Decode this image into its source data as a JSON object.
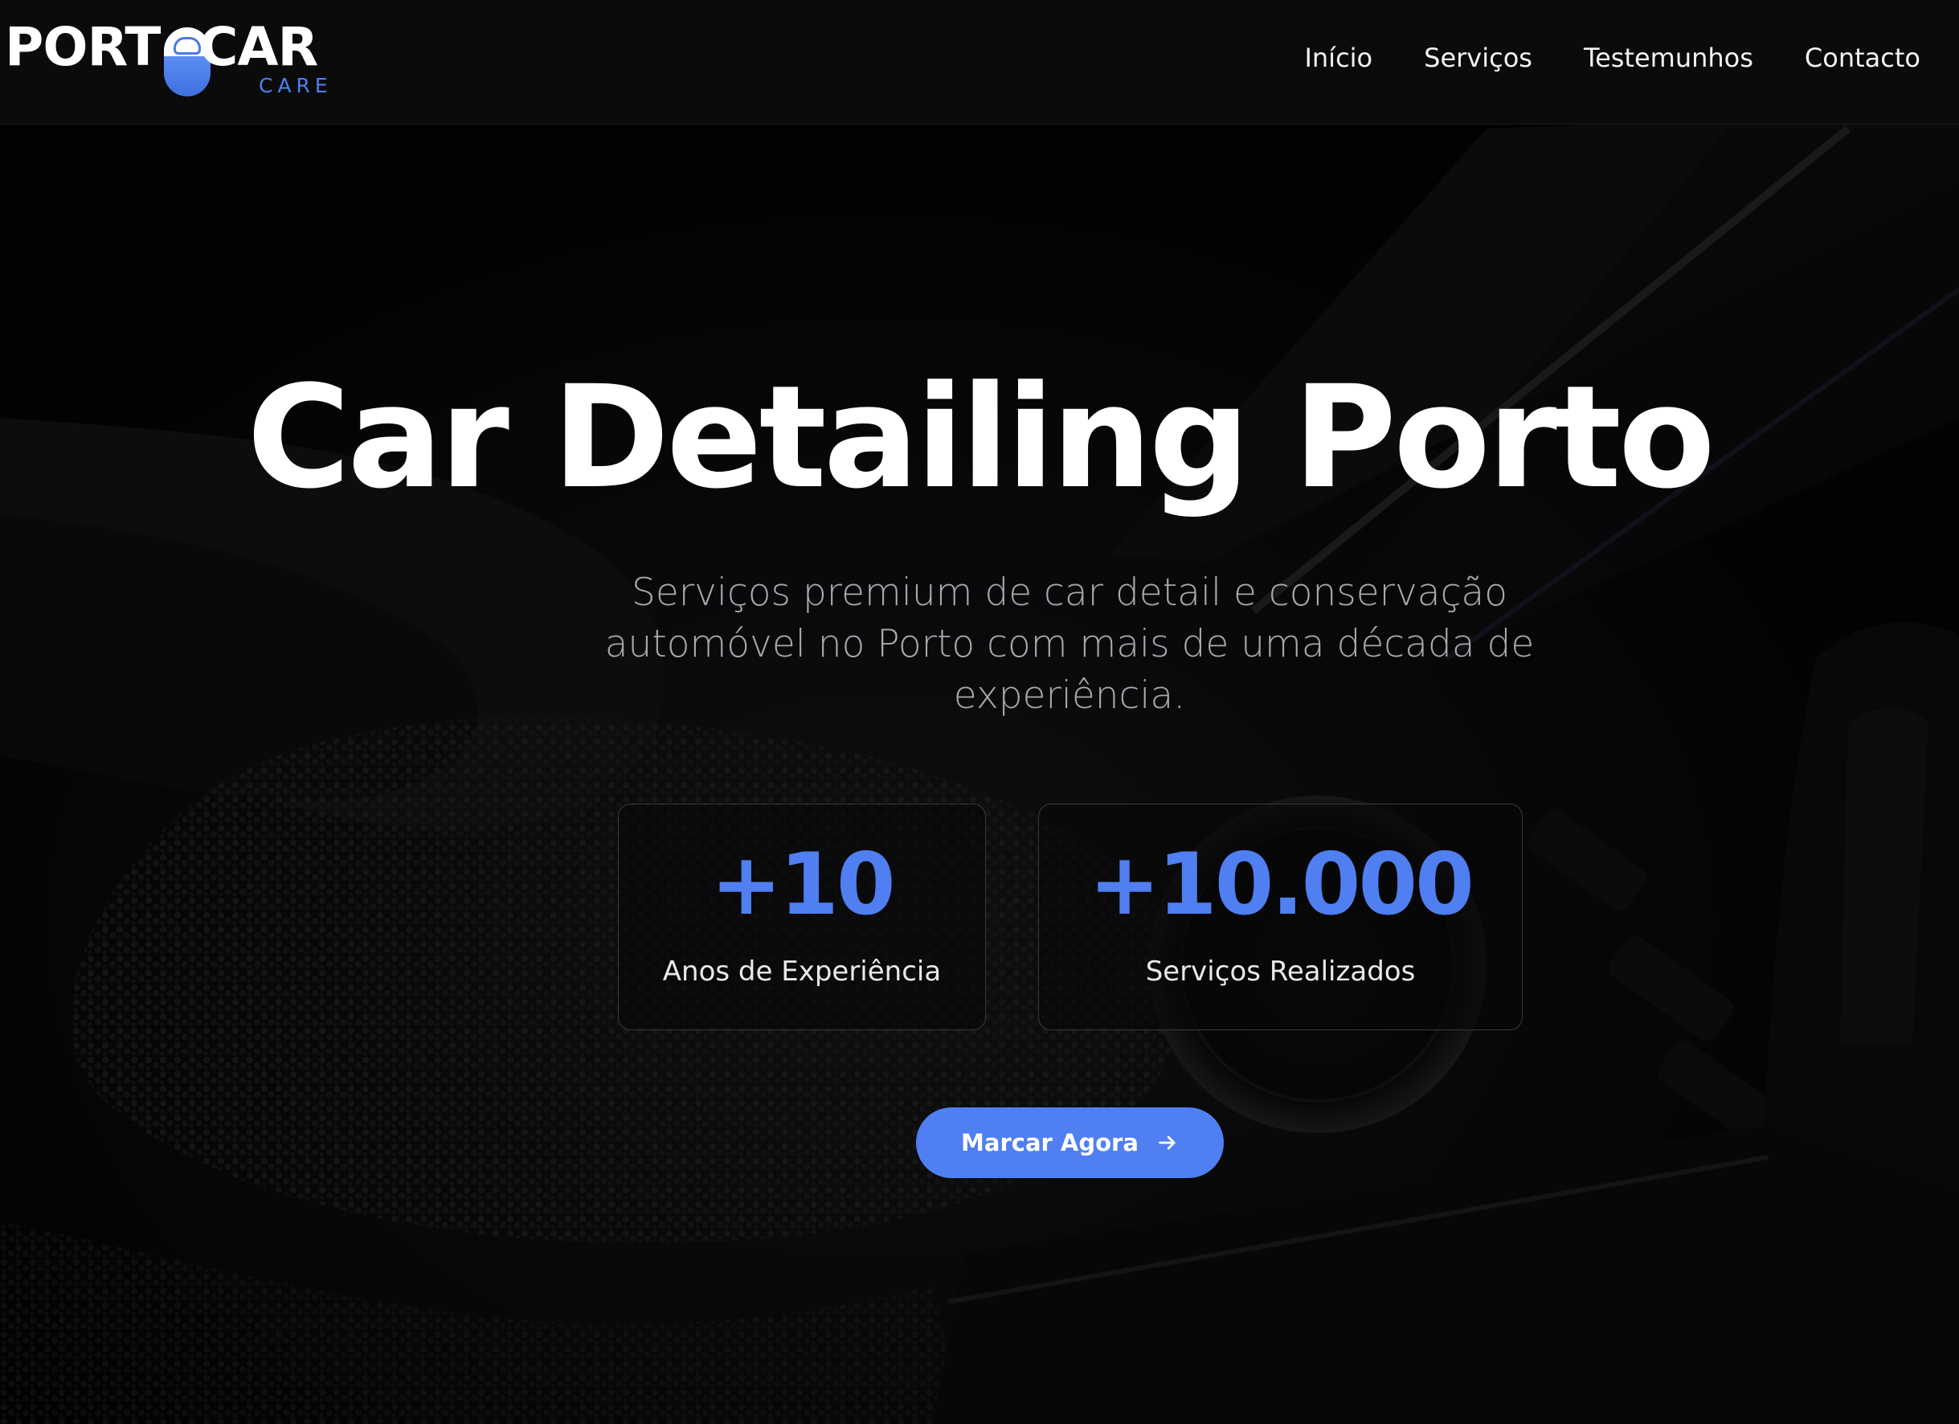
{
  "colors": {
    "accent": "#4f7ff0",
    "background": "#050506",
    "header_bg": "#0b0b0c"
  },
  "brand": {
    "word_left": "PORT",
    "word_right": "CAR",
    "sub": "CARE",
    "icon": "car-pill-logo-icon"
  },
  "nav": {
    "items": [
      {
        "label": "Início"
      },
      {
        "label": "Serviços"
      },
      {
        "label": "Testemunhos"
      },
      {
        "label": "Contacto"
      }
    ]
  },
  "hero": {
    "title": "Car Detailing Porto",
    "subtitle": "Serviços premium de car detail e conservação automóvel no Porto com mais de uma década de experiência."
  },
  "stats": [
    {
      "value": "+10",
      "label": "Anos de Experiência"
    },
    {
      "value": "+10.000",
      "label": "Serviços Realizados"
    }
  ],
  "cta": {
    "label": "Marcar Agora",
    "icon": "arrow-right-icon"
  }
}
